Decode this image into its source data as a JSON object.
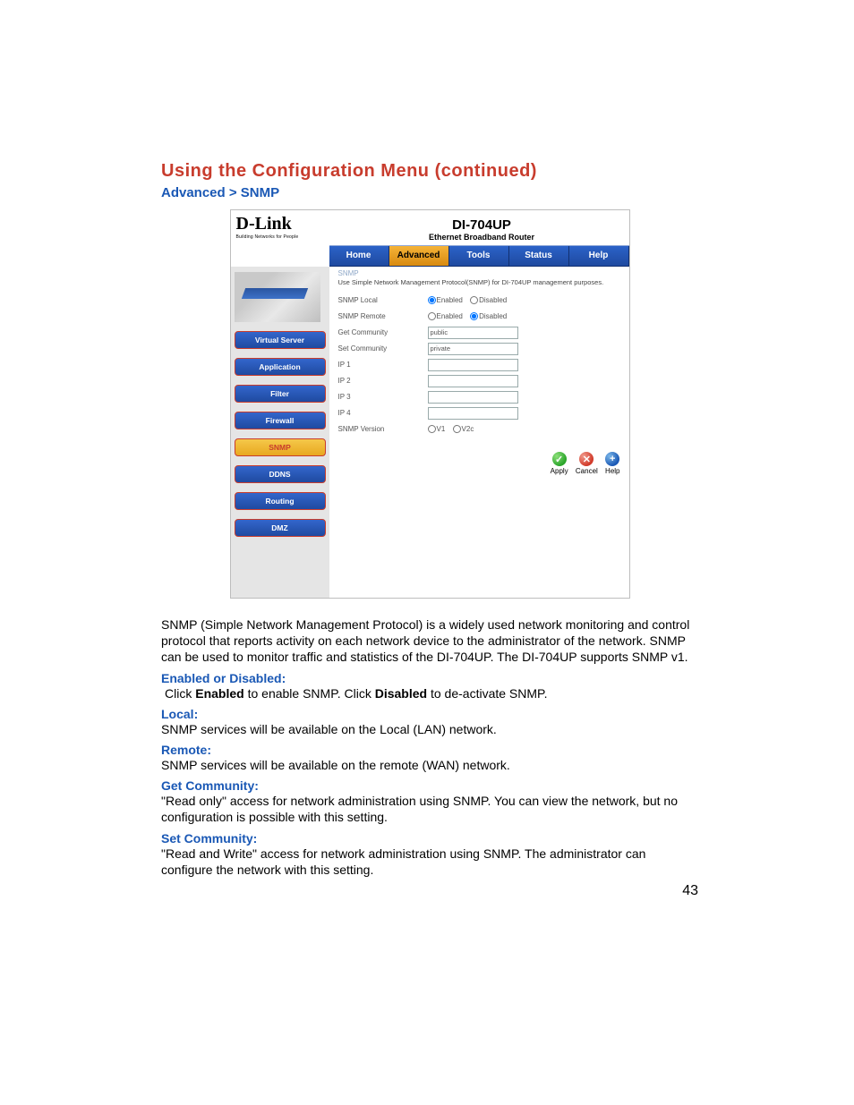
{
  "headings": {
    "main": "Using the Configuration Menu (continued)",
    "breadcrumb": "Advanced > SNMP"
  },
  "screenshot": {
    "logo": "D-Link",
    "logo_sub": "Building Networks for People",
    "model": "DI-704UP",
    "model_sub": "Ethernet Broadband Router",
    "tabs": [
      "Home",
      "Advanced",
      "Tools",
      "Status",
      "Help"
    ],
    "active_tab": 1,
    "side_buttons": [
      "Virtual Server",
      "Application",
      "Filter",
      "Firewall",
      "SNMP",
      "DDNS",
      "Routing",
      "DMZ"
    ],
    "active_side": 4,
    "section_label": "SNMP",
    "section_desc": "Use Simple Network Management Protocol(SNMP) for DI-704UP management purposes.",
    "rows": {
      "snmp_local": {
        "label": "SNMP Local",
        "enabled": "Enabled",
        "disabled": "Disabled",
        "sel": "enabled"
      },
      "snmp_remote": {
        "label": "SNMP Remote",
        "enabled": "Enabled",
        "disabled": "Disabled",
        "sel": "disabled"
      },
      "get_comm": {
        "label": "Get Community",
        "value": "public"
      },
      "set_comm": {
        "label": "Set Community",
        "value": "private"
      },
      "ip1": {
        "label": "IP 1",
        "value": ""
      },
      "ip2": {
        "label": "IP 2",
        "value": ""
      },
      "ip3": {
        "label": "IP 3",
        "value": ""
      },
      "ip4": {
        "label": "IP 4",
        "value": ""
      },
      "version": {
        "label": "SNMP Version",
        "v1": "V1",
        "v2": "V2c"
      }
    },
    "actions": {
      "apply": "Apply",
      "cancel": "Cancel",
      "help": "Help"
    }
  },
  "paragraphs": {
    "intro": "SNMP (Simple Network Management Protocol) is a widely used network monitoring and control protocol that reports activity on each network device to the administrator of the network. SNMP can be used to monitor traffic and statistics of the DI-704UP. The DI-704UP supports SNMP v1.",
    "titles": {
      "enabled": "Enabled or Disabled:",
      "local": "Local:",
      "remote": "Remote:",
      "get": "Get Community:",
      "set": "Set Community:"
    },
    "enabled_pre": " Click ",
    "enabled_mid1": " to enable SNMP. Click ",
    "enabled_mid2": " to de-activate SNMP.",
    "enabled_bold1": "Enabled",
    "enabled_bold2": "Disabled",
    "local": "SNMP services will be available on the Local (LAN) network.",
    "remote": "SNMP services will be available on the remote (WAN) network.",
    "get": "\"Read only\" access for network administration using SNMP.  You can view the network, but no configuration is possible with this setting.",
    "set": "\"Read and Write\" access for network administration using SNMP.  The administrator can configure the network with this setting."
  },
  "page_number": "43"
}
